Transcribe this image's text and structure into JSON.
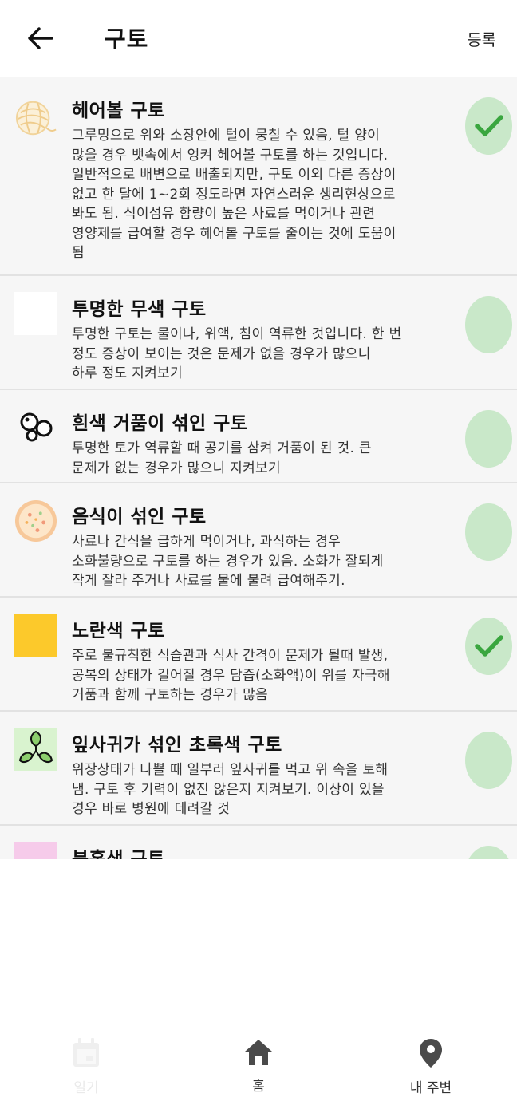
{
  "header": {
    "title": "구토",
    "register_label": "등록"
  },
  "items": [
    {
      "title": "헤어볼 구토",
      "icon": "yarn-ball-icon",
      "checked": true,
      "desc": [
        "그루밍으로 위와 소장안에 털이 뭉칠 수 있음, 털 양이",
        "많을 경우 뱃속에서 엉켜 헤어볼 구토를 하는 것입니다.",
        "일반적으로 배변으로 배출되지만, 구토 이외 다른 증상이",
        "없고 한 달에 1~2회 정도라면 자연스러운 생리현상으로",
        "봐도 됨. 식이섬유 함량이 높은 사료를 먹이거나 관련",
        "영양제를 급여할 경우 헤어볼 구토를 줄이는 것에 도움이",
        "됨"
      ]
    },
    {
      "title": "투명한 무색 구토",
      "icon": "clear-color-swatch",
      "checked": false,
      "desc": [
        "투명한 구토는 물이나, 위액, 침이 역류한 것입니다. 한 번",
        "정도 증상이 보이는 것은 문제가 없을 경우가 많으니",
        "하루 정도 지켜보기"
      ]
    },
    {
      "title": "흰색 거품이 섞인 구토",
      "icon": "bubbles-icon",
      "checked": false,
      "desc": [
        "투명한 토가 역류할 때 공기를 삼켜 거품이 된 것. 큰",
        "문제가 없는 경우가 많으니 지켜보기"
      ]
    },
    {
      "title": "음식이 섞인 구토",
      "icon": "pizza-food-icon",
      "checked": false,
      "desc": [
        "사료나 간식을 급하게 먹이거나, 과식하는 경우",
        "소화불량으로 구토를 하는 경우가 있음. 소화가 잘되게",
        "작게 잘라 주거나 사료를 물에 불려 급여해주기."
      ]
    },
    {
      "title": "노란색 구토",
      "icon": "yellow-color-swatch",
      "checked": true,
      "desc": [
        "주로 불규칙한 식습관과 식사 간격이 문제가 될때 발생,",
        "공복의 상태가 길어질 경우 담즙(소화액)이 위를 자극해",
        "거품과 함께 구토하는 경우가 많음"
      ]
    },
    {
      "title": "잎사귀가 섞인 초록색 구토",
      "icon": "leaves-icon",
      "checked": false,
      "desc": [
        "위장상태가 나쁠 때 일부러 잎사귀를 먹고 위 속을 토해",
        "냄. 구토 후 기력이 없진 않은지 지켜보기. 이상이 있을",
        "경우 바로 병원에 데려갈 것"
      ]
    },
    {
      "title": "분홍색 구토",
      "icon": "pink-color-swatch",
      "checked": false,
      "desc": []
    }
  ],
  "nav": {
    "diary_label": "일기",
    "home_label": "홈",
    "nearby_label": "내 주변"
  },
  "colors": {
    "check_bg": "#c9e8c9",
    "check_mark": "#3aa63f",
    "yellow_swatch": "#fcc92b",
    "pink_swatch": "#f6cbea"
  }
}
